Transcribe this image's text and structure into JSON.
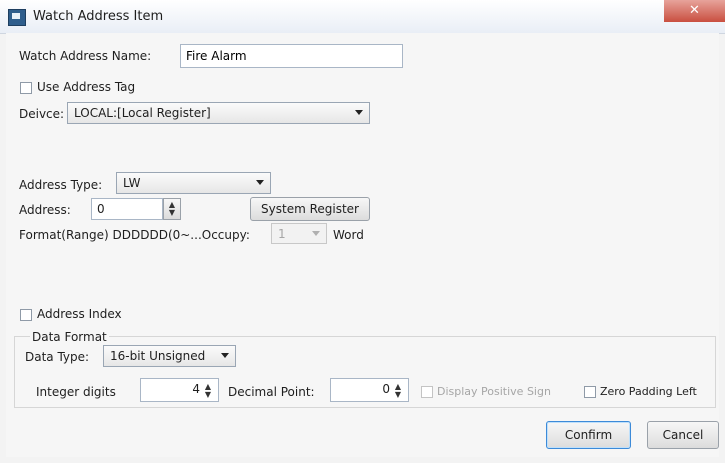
{
  "window": {
    "title": "Watch Address Item",
    "close_glyph": "✕"
  },
  "form": {
    "name_label": "Watch Address Name:",
    "name_value": "Fire Alarm",
    "use_tag_label": "Use Address Tag",
    "device_label": "Deivce:",
    "device_value": "LOCAL:[Local Register]",
    "address_type_label": "Address Type:",
    "address_type_value": "LW",
    "address_label": "Address:",
    "address_value": "0",
    "system_register_label": "System Register",
    "format_label": "Format(Range) DDDDDD(0~...Occupy:",
    "occupy_value": "1",
    "occupy_unit": "Word",
    "address_index_label": "Address Index"
  },
  "data_format": {
    "group_label": "Data Format",
    "data_type_label": "Data Type:",
    "data_type_value": "16-bit Unsigned",
    "integer_digits_label": "Integer digits",
    "integer_digits_value": "4",
    "decimal_point_label": "Decimal Point:",
    "decimal_point_value": "0",
    "display_positive_sign_label": "Display Positive Sign",
    "zero_padding_left_label": "Zero Padding Left"
  },
  "buttons": {
    "confirm": "Confirm",
    "cancel": "Cancel"
  }
}
